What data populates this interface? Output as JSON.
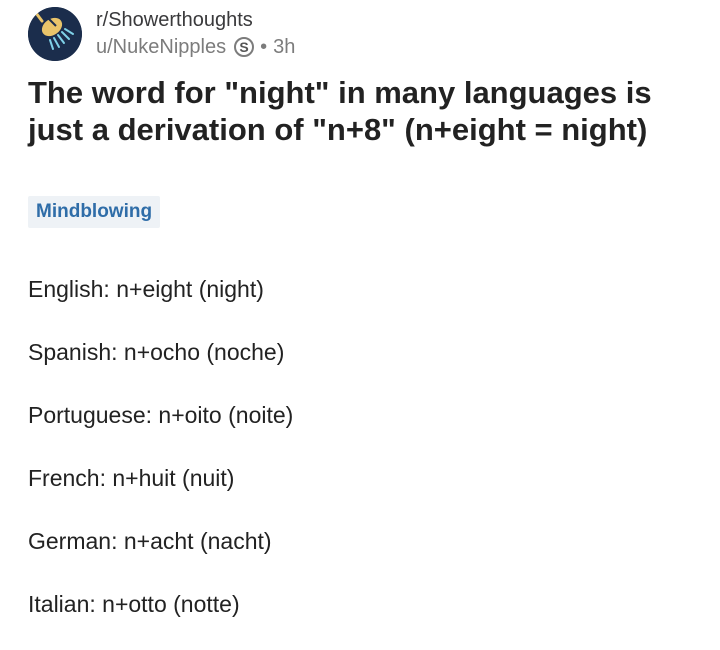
{
  "post": {
    "subreddit": "r/Showerthoughts",
    "username": "u/NukeNipples",
    "badge": "S",
    "separator": "•",
    "time": "3h",
    "avatar_icon": "showerhead-icon",
    "title": "The word for \"night\" in many languages is just a derivation of \"n+8\" (n+eight = night)",
    "flair": "Mindblowing"
  },
  "body": {
    "lines": [
      "English: n+eight (night)",
      "Spanish: n+ocho  (noche)",
      "Portuguese: n+oito (noite)",
      "French: n+huit  (nuit)",
      "German: n+acht  (nacht)",
      "Italian: n+otto  (notte)"
    ]
  },
  "colors": {
    "avatar_bg": "#1b2d4c",
    "flair_bg": "#eef2f6",
    "flair_text": "#2f6da8"
  }
}
